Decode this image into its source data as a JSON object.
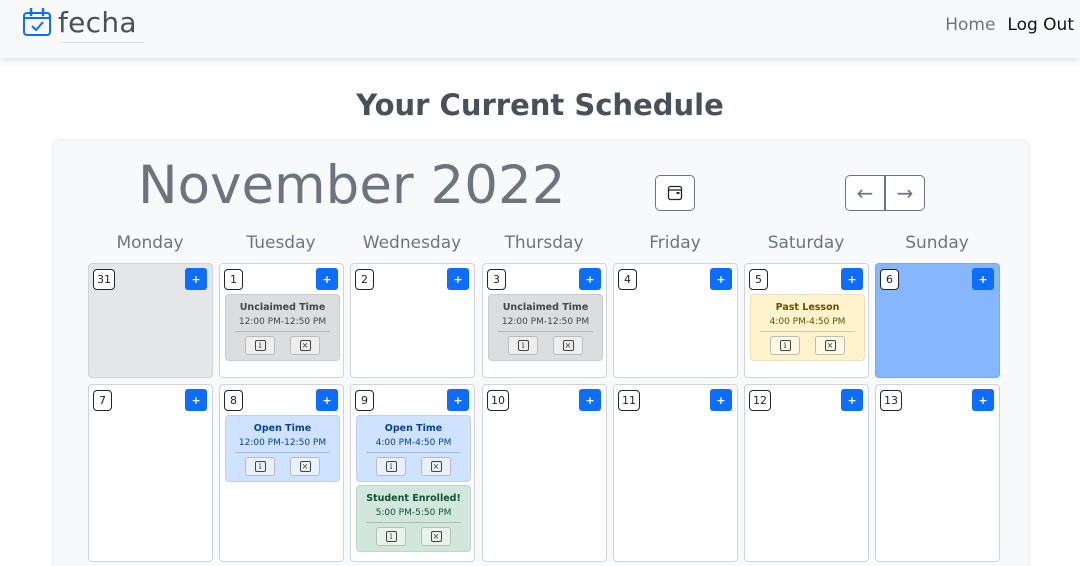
{
  "navbar": {
    "brand": "fecha",
    "links": [
      {
        "label": "Home",
        "active": false
      },
      {
        "label": "Log Out",
        "active": true
      }
    ]
  },
  "page_title": "Your Current Schedule",
  "calendar": {
    "month_title": "November 2022",
    "today_button_icon": "calendar-today-icon",
    "prev_label": "←",
    "next_label": "→",
    "add_label": "+",
    "weekdays": [
      "Monday",
      "Tuesday",
      "Wednesday",
      "Thursday",
      "Friday",
      "Saturday",
      "Sunday"
    ],
    "weeks": [
      [
        {
          "day": "31",
          "state": "past",
          "events": []
        },
        {
          "day": "1",
          "state": "",
          "events": [
            {
              "kind": "unclaimed",
              "title": "Unclaimed Time",
              "time": "12:00 PM-12:50 PM"
            }
          ]
        },
        {
          "day": "2",
          "state": "",
          "events": []
        },
        {
          "day": "3",
          "state": "",
          "events": [
            {
              "kind": "unclaimed",
              "title": "Unclaimed Time",
              "time": "12:00 PM-12:50 PM"
            }
          ]
        },
        {
          "day": "4",
          "state": "",
          "events": []
        },
        {
          "day": "5",
          "state": "",
          "events": [
            {
              "kind": "past",
              "title": "Past Lesson",
              "time": "4:00 PM-4:50 PM"
            }
          ]
        },
        {
          "day": "6",
          "state": "today",
          "events": []
        }
      ],
      [
        {
          "day": "7",
          "state": "",
          "events": []
        },
        {
          "day": "8",
          "state": "",
          "events": [
            {
              "kind": "open",
              "title": "Open Time",
              "time": "12:00 PM-12:50 PM"
            }
          ]
        },
        {
          "day": "9",
          "state": "",
          "events": [
            {
              "kind": "open",
              "title": "Open Time",
              "time": "4:00 PM-4:50 PM"
            },
            {
              "kind": "enrolled",
              "title": "Student Enrolled!",
              "time": "5:00 PM-5:50 PM"
            }
          ]
        },
        {
          "day": "10",
          "state": "",
          "events": []
        },
        {
          "day": "11",
          "state": "",
          "events": []
        },
        {
          "day": "12",
          "state": "",
          "events": []
        },
        {
          "day": "13",
          "state": "",
          "events": []
        }
      ]
    ],
    "event_info_icon": "info-icon",
    "event_delete_icon": "delete-x-icon"
  },
  "colors": {
    "primary": "#0d6efd",
    "today": "#86b7fe",
    "unclaimed": "#dcdddf",
    "open": "#cfe2ff",
    "past": "#fff3cd",
    "enrolled": "#d1e7dd"
  }
}
